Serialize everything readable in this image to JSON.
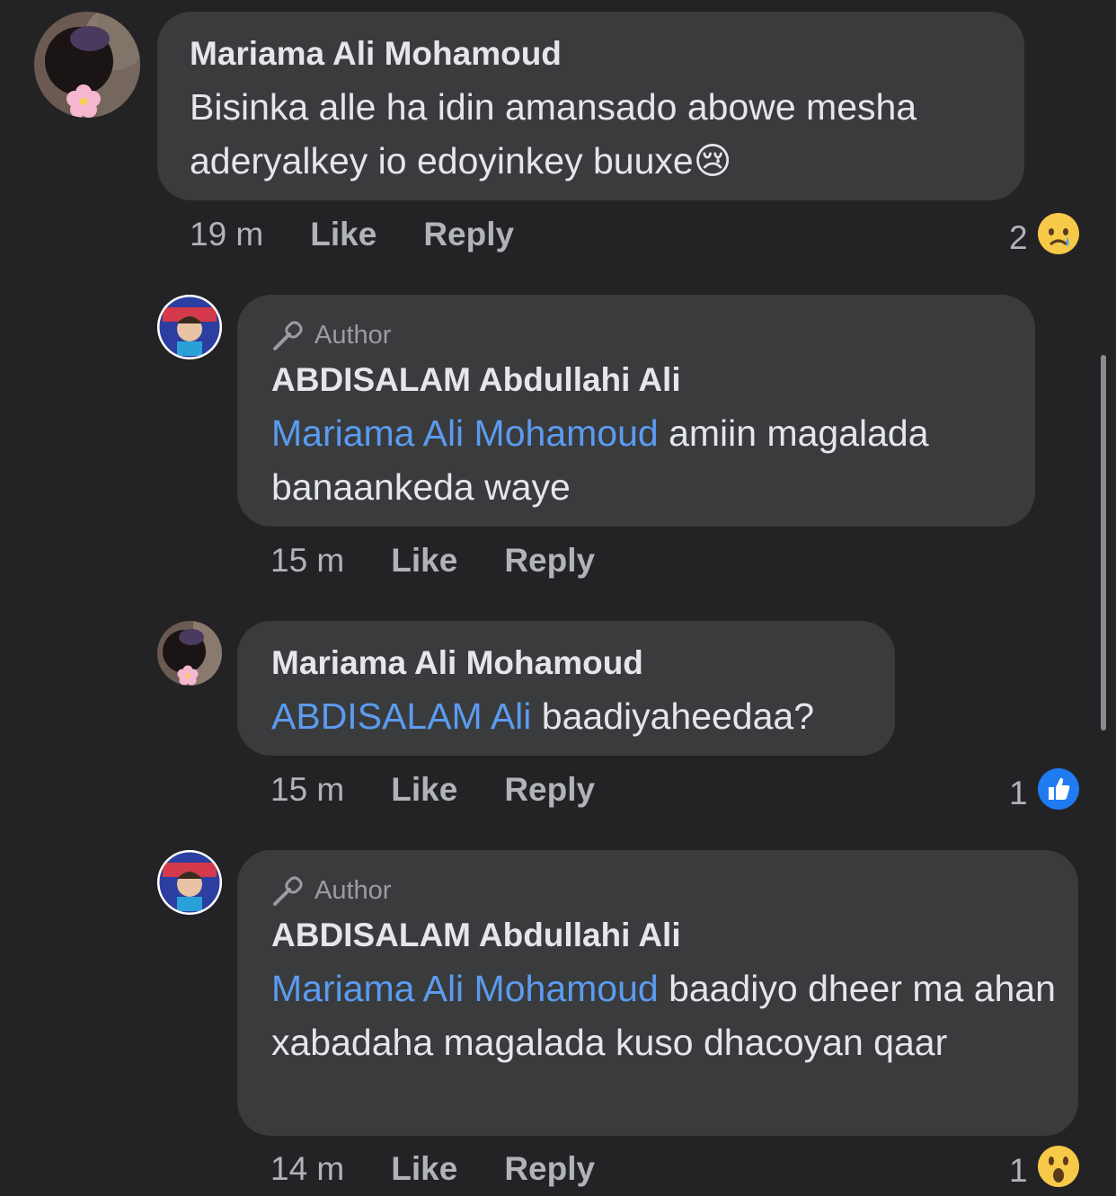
{
  "comments": [
    {
      "author": "Mariama Ali Mohamoud",
      "text": "Bisinka alle ha idin amansado abowe mesha aderyalkey io edoyinkey buuxe",
      "emoji": "😢",
      "time": "19 m",
      "like": "Like",
      "reply": "Reply",
      "reaction_count": "2",
      "reaction_icon": "sad-reaction-icon"
    },
    {
      "author_tag": "Author",
      "author": "ABDISALAM Abdullahi Ali",
      "mention": "Mariama Ali Mohamoud",
      "text": " amiin magalada banaankeda waye",
      "time": "15 m",
      "like": "Like",
      "reply": "Reply"
    },
    {
      "author": "Mariama Ali Mohamoud",
      "mention": "ABDISALAM Ali",
      "text": " baadiyaheedaa?",
      "time": "15 m",
      "like": "Like",
      "reply": "Reply",
      "reaction_count": "1",
      "reaction_icon": "like-reaction-icon"
    },
    {
      "author_tag": "Author",
      "author": "ABDISALAM Abdullahi Ali",
      "mention": "Mariama Ali Mohamoud",
      "text": " baadiyo dheer ma ahan xabadaha magalada kuso dhacoyan qaar",
      "time": "14 m",
      "like": "Like",
      "reply": "Reply",
      "reaction_count": "1",
      "reaction_icon": "wow-reaction-icon"
    }
  ],
  "colors": {
    "background": "#232325",
    "bubble": "#3a3b3d",
    "mention": "#5b9bf0",
    "muted": "#b0b3b8"
  }
}
